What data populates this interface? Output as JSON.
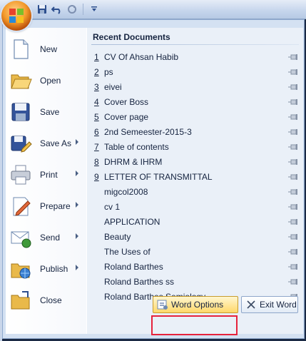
{
  "quick_access": {
    "icons": [
      "save-icon",
      "undo-icon",
      "redo-icon",
      "customize-icon"
    ]
  },
  "left_menu": {
    "items": [
      {
        "label": "New",
        "icon": "new-document-icon",
        "submenu": false
      },
      {
        "label": "Open",
        "icon": "open-folder-icon",
        "submenu": false
      },
      {
        "label": "Save",
        "icon": "save-icon",
        "submenu": false
      },
      {
        "label": "Save As",
        "icon": "save-as-icon",
        "submenu": true
      },
      {
        "label": "Print",
        "icon": "printer-icon",
        "submenu": true
      },
      {
        "label": "Prepare",
        "icon": "prepare-icon",
        "submenu": true
      },
      {
        "label": "Send",
        "icon": "send-icon",
        "submenu": true
      },
      {
        "label": "Publish",
        "icon": "publish-icon",
        "submenu": true
      },
      {
        "label": "Close",
        "icon": "close-folder-icon",
        "submenu": false
      }
    ]
  },
  "recent": {
    "title": "Recent Documents",
    "documents": [
      {
        "num": "1",
        "name": "CV Of Ahsan Habib"
      },
      {
        "num": "2",
        "name": "ps"
      },
      {
        "num": "3",
        "name": "eivei"
      },
      {
        "num": "4",
        "name": "Cover Boss"
      },
      {
        "num": "5",
        "name": "Cover page"
      },
      {
        "num": "6",
        "name": "2nd Semeester-2015-3"
      },
      {
        "num": "7",
        "name": "Table of contents"
      },
      {
        "num": "8",
        "name": "DHRM & IHRM"
      },
      {
        "num": "9",
        "name": "LETTER OF TRANSMITTAL"
      },
      {
        "num": "",
        "name": "migcol2008"
      },
      {
        "num": "",
        "name": "cv 1"
      },
      {
        "num": "",
        "name": "APPLICATION"
      },
      {
        "num": "",
        "name": "Beauty"
      },
      {
        "num": "",
        "name": "The Uses of"
      },
      {
        "num": "",
        "name": "Roland Barthes"
      },
      {
        "num": "",
        "name": "Roland Barthes ss"
      },
      {
        "num": "",
        "name": "Roland Barthes Semiology"
      }
    ]
  },
  "bottom": {
    "options_label": "Word Options",
    "exit_label": "Exit Word"
  },
  "colors": {
    "highlight": "#e6223c",
    "panel": "#d4e1f2",
    "accent": "#f39a2b"
  }
}
